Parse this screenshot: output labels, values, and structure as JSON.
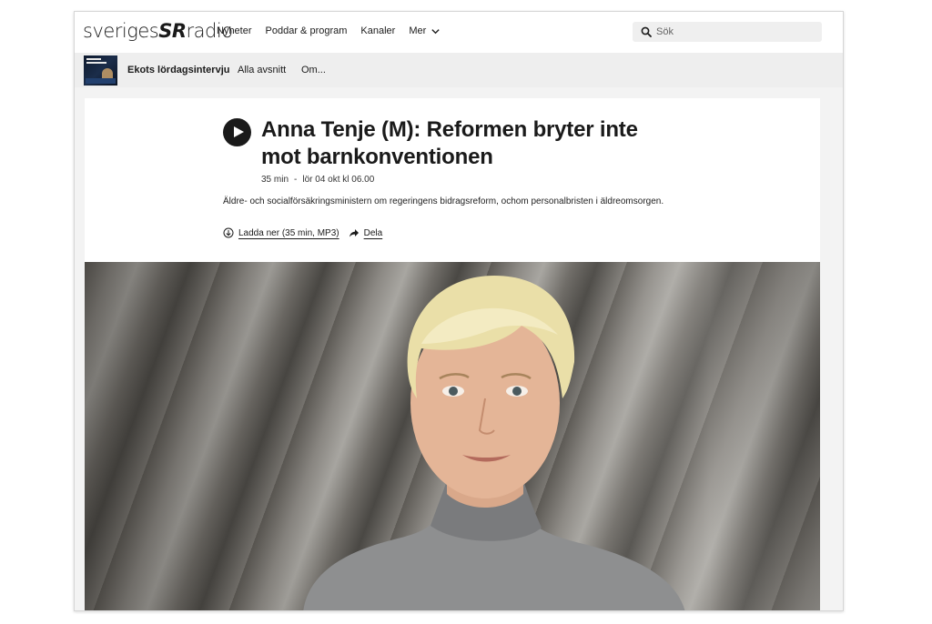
{
  "header": {
    "logo_text": "sveriges",
    "logo_text_sr": "SR",
    "logo_text_radio": "radio",
    "nav": [
      "Nyheter",
      "Poddar & program",
      "Kanaler",
      "Mer"
    ],
    "search": {
      "placeholder": "Sök"
    }
  },
  "program_bar": {
    "title": "Ekots lördagsintervju",
    "links": [
      "Alla avsnitt",
      "Om..."
    ]
  },
  "episode": {
    "title": "Anna Tenje (M): Reformen bryter inte mot barnkonventionen",
    "duration": "35 min",
    "separator": "-",
    "date": "lör 04 okt kl 06.00",
    "description": "Äldre- och socialförsäkringsministern om regeringens bidragsreform, ochom personalbristen i äldreomsorgen.",
    "download_label": "Ladda ner (35 min, MP3)",
    "share_label": "Dela"
  },
  "icons": {
    "search": "search-icon",
    "chevron": "chevron-down-icon",
    "play": "play-icon",
    "download": "download-icon",
    "share": "share-icon"
  },
  "colors": {
    "text": "#1a1a1a",
    "program_bar_bg": "#eeeeee",
    "search_bg": "#efefef"
  }
}
